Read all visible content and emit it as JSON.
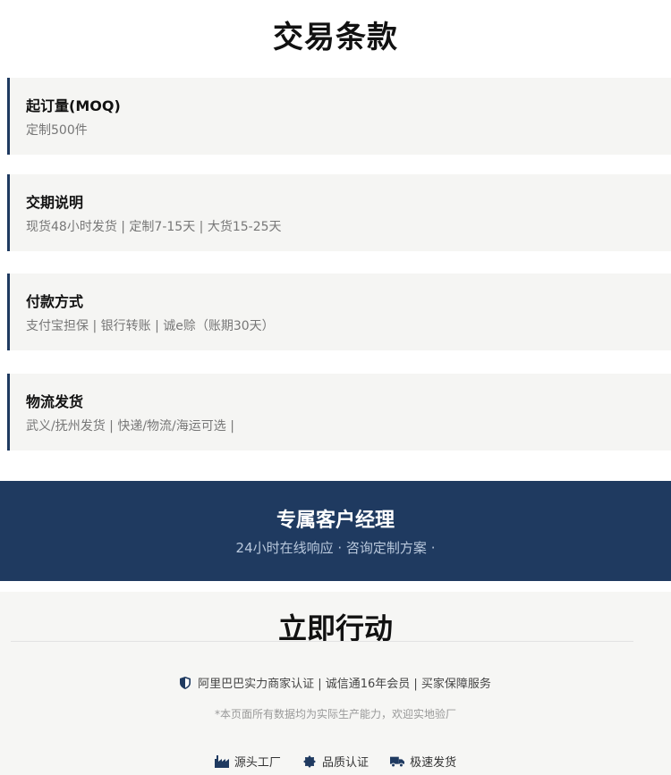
{
  "page_title": "交易条款",
  "terms": [
    {
      "title": "起订量(MOQ)",
      "value": "定制500件"
    },
    {
      "title": "交期说明",
      "value": "现货48小时发货 | 定制7-15天 | 大货15-25天"
    },
    {
      "title": "付款方式",
      "value": "支付宝担保 | 银行转账 | 诚e赊（账期30天）"
    },
    {
      "title": "物流发货",
      "value": "武义/抚州发货 | 快递/物流/海运可选 |"
    }
  ],
  "banner": {
    "title": "专属客户经理",
    "subtitle": "24小时在线响应 · 咨询定制方案 ·"
  },
  "cta": {
    "title": "立即行动",
    "certification": "阿里巴巴实力商家认证 | 诚信通16年会员 | 买家保障服务",
    "note": "*本页面所有数据均为实际生产能力，欢迎实地验厂",
    "badges": [
      {
        "icon": "factory-icon",
        "label": "源头工厂"
      },
      {
        "icon": "quality-badge-icon",
        "label": "品质认证"
      },
      {
        "icon": "truck-icon",
        "label": "极速发货"
      }
    ]
  },
  "colors": {
    "accent": "#1f3a60",
    "card_bg": "#f5f5f3"
  }
}
